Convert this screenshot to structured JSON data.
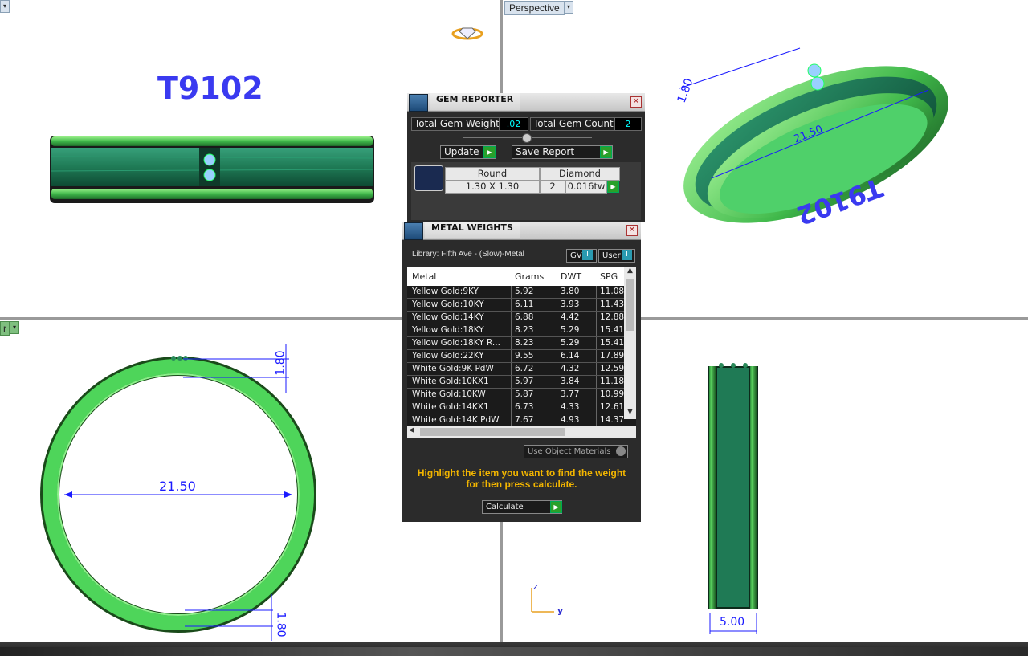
{
  "viewports": {
    "top_left": {
      "engraving": "T9102"
    },
    "top_right": {
      "label": "Perspective",
      "dim_width": "1.80",
      "dim_length": "21.50",
      "engraving": "T9102"
    },
    "bottom_left": {
      "label": "r",
      "dim_top": "1.80",
      "dim_diameter": "21.50",
      "dim_bottom": "1.80"
    },
    "bottom_right": {
      "dim_width": "5.00",
      "axis_z": "z",
      "axis_y": "y"
    }
  },
  "gem_reporter": {
    "title": "GEM REPORTER",
    "total_weight_label": "Total Gem Weight",
    "total_weight_value": ".02",
    "total_count_label": "Total Gem Count",
    "total_count_value": "2",
    "update_label": "Update",
    "save_report_label": "Save Report",
    "gems": [
      {
        "shape": "Round",
        "size": "1.30 X 1.30",
        "material": "Diamond",
        "count": "2",
        "weight": "0.016tw"
      }
    ]
  },
  "metal_weights": {
    "title": "METAL WEIGHTS",
    "library": "Library: Fifth Ave - (Slow)-Metal",
    "gv_label": "GV",
    "user_label": "User",
    "columns": [
      "Metal",
      "Grams",
      "DWT",
      "SPG"
    ],
    "rows": [
      [
        "Yellow Gold:9KY",
        "5.92",
        "3.80",
        "11.08"
      ],
      [
        "Yellow Gold:10KY",
        "6.11",
        "3.93",
        "11.43"
      ],
      [
        "Yellow Gold:14KY",
        "6.88",
        "4.42",
        "12.88"
      ],
      [
        "Yellow Gold:18KY",
        "8.23",
        "5.29",
        "15.41"
      ],
      [
        "Yellow Gold:18KY R...",
        "8.23",
        "5.29",
        "15.41"
      ],
      [
        "Yellow Gold:22KY",
        "9.55",
        "6.14",
        "17.89"
      ],
      [
        "White Gold:9K PdW",
        "6.72",
        "4.32",
        "12.59"
      ],
      [
        "White Gold:10KX1",
        "5.97",
        "3.84",
        "11.18"
      ],
      [
        "White Gold:10KW",
        "5.87",
        "3.77",
        "10.99"
      ],
      [
        "White Gold:14KX1",
        "6.73",
        "4.33",
        "12.61"
      ],
      [
        "White Gold:14K PdW",
        "7.67",
        "4.93",
        "14.37"
      ]
    ],
    "use_object_materials": "Use Object Materials",
    "hint": "Highlight the item you want to find the weight for then press calculate.",
    "calculate_label": "Calculate"
  },
  "colors": {
    "ring_green": "#3fb84a",
    "ring_dark": "#1f7a55",
    "dim_blue": "#1a1aff",
    "panel_bg": "#2b2b2b",
    "hint_yellow": "#f2b500"
  }
}
